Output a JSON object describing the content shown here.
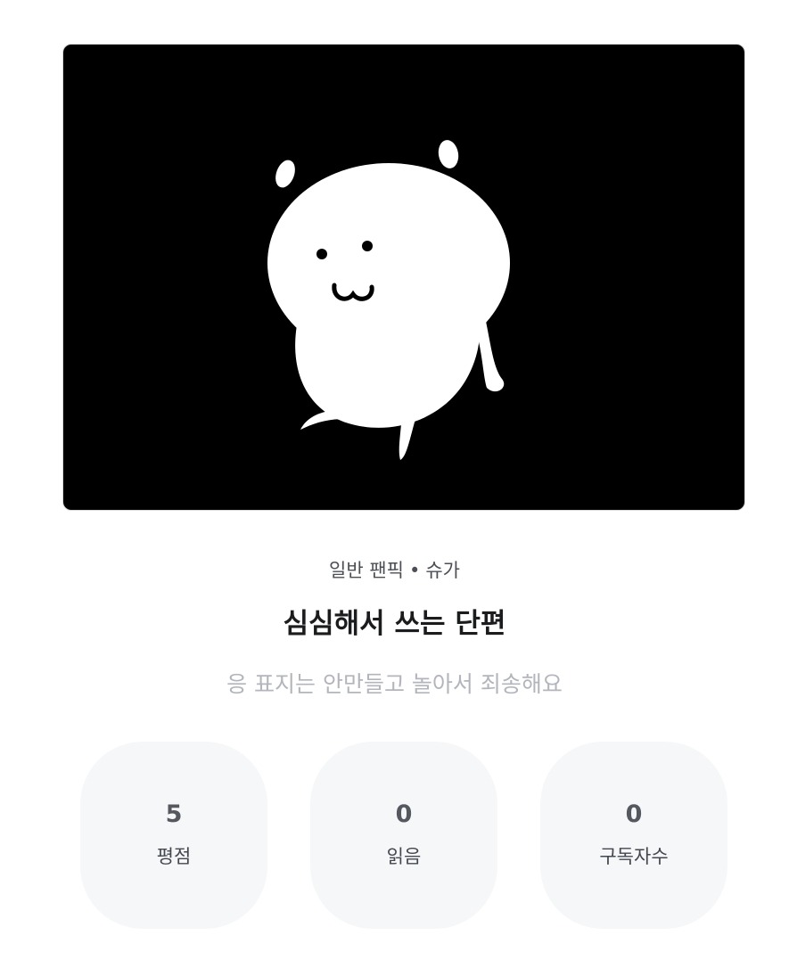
{
  "work": {
    "cover_alt_icon": "white-bear-illustration",
    "category": "일반 팬픽",
    "separator": "•",
    "tag": "슈가",
    "title": "심심해서 쓰는 단편",
    "description": "응 표지는 안만들고 놀아서 죄송해요"
  },
  "stats": [
    {
      "value": "5",
      "label": "평점"
    },
    {
      "value": "0",
      "label": "읽음"
    },
    {
      "value": "0",
      "label": "구독자수"
    }
  ]
}
